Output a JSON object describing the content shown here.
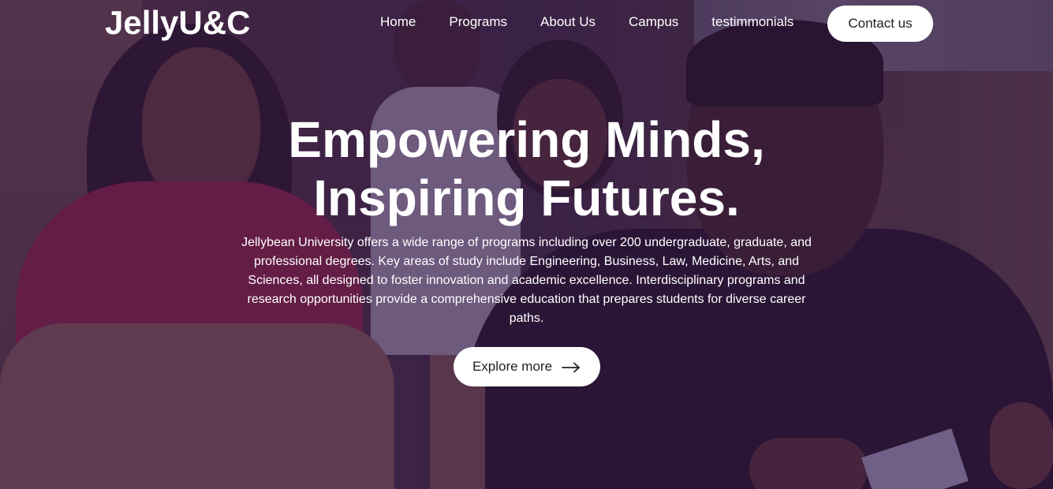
{
  "brand": {
    "logo": "JellyU&C"
  },
  "nav": {
    "items": [
      {
        "label": "Home"
      },
      {
        "label": "Programs"
      },
      {
        "label": "About Us"
      },
      {
        "label": "Campus"
      },
      {
        "label": "testimmonials"
      }
    ],
    "contact_label": "Contact us"
  },
  "hero": {
    "title_line1": "Empowering Minds,",
    "title_line2": "Inspiring Futures.",
    "description": "Jellybean University offers a wide range of programs including over 200 undergraduate, graduate, and professional degrees. Key areas of study include Engineering, Business, Law, Medicine, Arts, and Sciences, all designed to foster innovation and academic excellence. Interdisciplinary programs and research opportunities provide a comprehensive education that prepares students for diverse career paths.",
    "cta_label": "Explore more",
    "cta_icon": "arrow-right-icon"
  },
  "colors": {
    "overlay": "#30164a",
    "button_bg": "#ffffff",
    "text_primary": "#ffffff",
    "button_text": "#222222"
  }
}
